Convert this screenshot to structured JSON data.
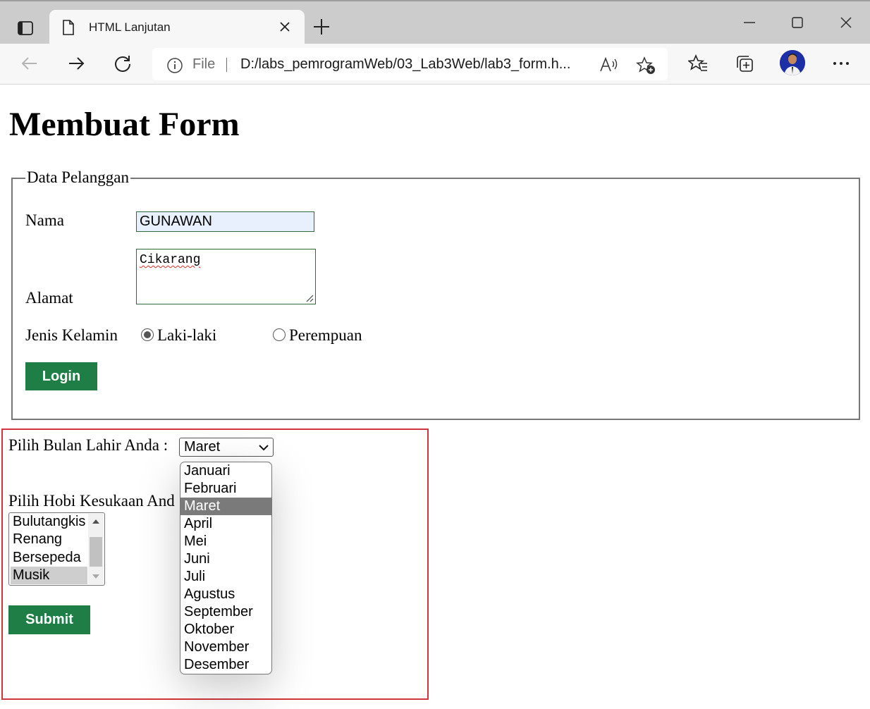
{
  "browser": {
    "tab_title": "HTML Lanjutan",
    "address_label": "File",
    "url": "D:/labs_pemrogramWeb/03_Lab3Web/lab3_form.h..."
  },
  "page": {
    "title": "Membuat Form",
    "fieldset": {
      "legend": "Data Pelanggan",
      "nama_label": "Nama",
      "nama_value": "GUNAWAN",
      "alamat_label": "Alamat",
      "alamat_value": "Cikarang",
      "gender_label": "Jenis Kelamin",
      "gender_options": [
        {
          "label": "Laki-laki",
          "checked": true
        },
        {
          "label": "Perempuan",
          "checked": false
        }
      ],
      "login_button": "Login"
    },
    "bulan": {
      "label": "Pilih Bulan Lahir Anda :",
      "selected": "Maret",
      "options": [
        "Januari",
        "Februari",
        "Maret",
        "April",
        "Mei",
        "Juni",
        "Juli",
        "Agustus",
        "September",
        "Oktober",
        "November",
        "Desember"
      ]
    },
    "hobi": {
      "label": "Pilih Hobi Kesukaan And",
      "options": [
        "Bulutangkis",
        "Renang",
        "Bersepeda",
        "Musik"
      ],
      "selected": "Musik"
    },
    "submit_button": "Submit"
  },
  "colors": {
    "button_green": "#1e7e45",
    "red_border": "#d1343c",
    "autofill_bg": "#e8f0fe"
  }
}
